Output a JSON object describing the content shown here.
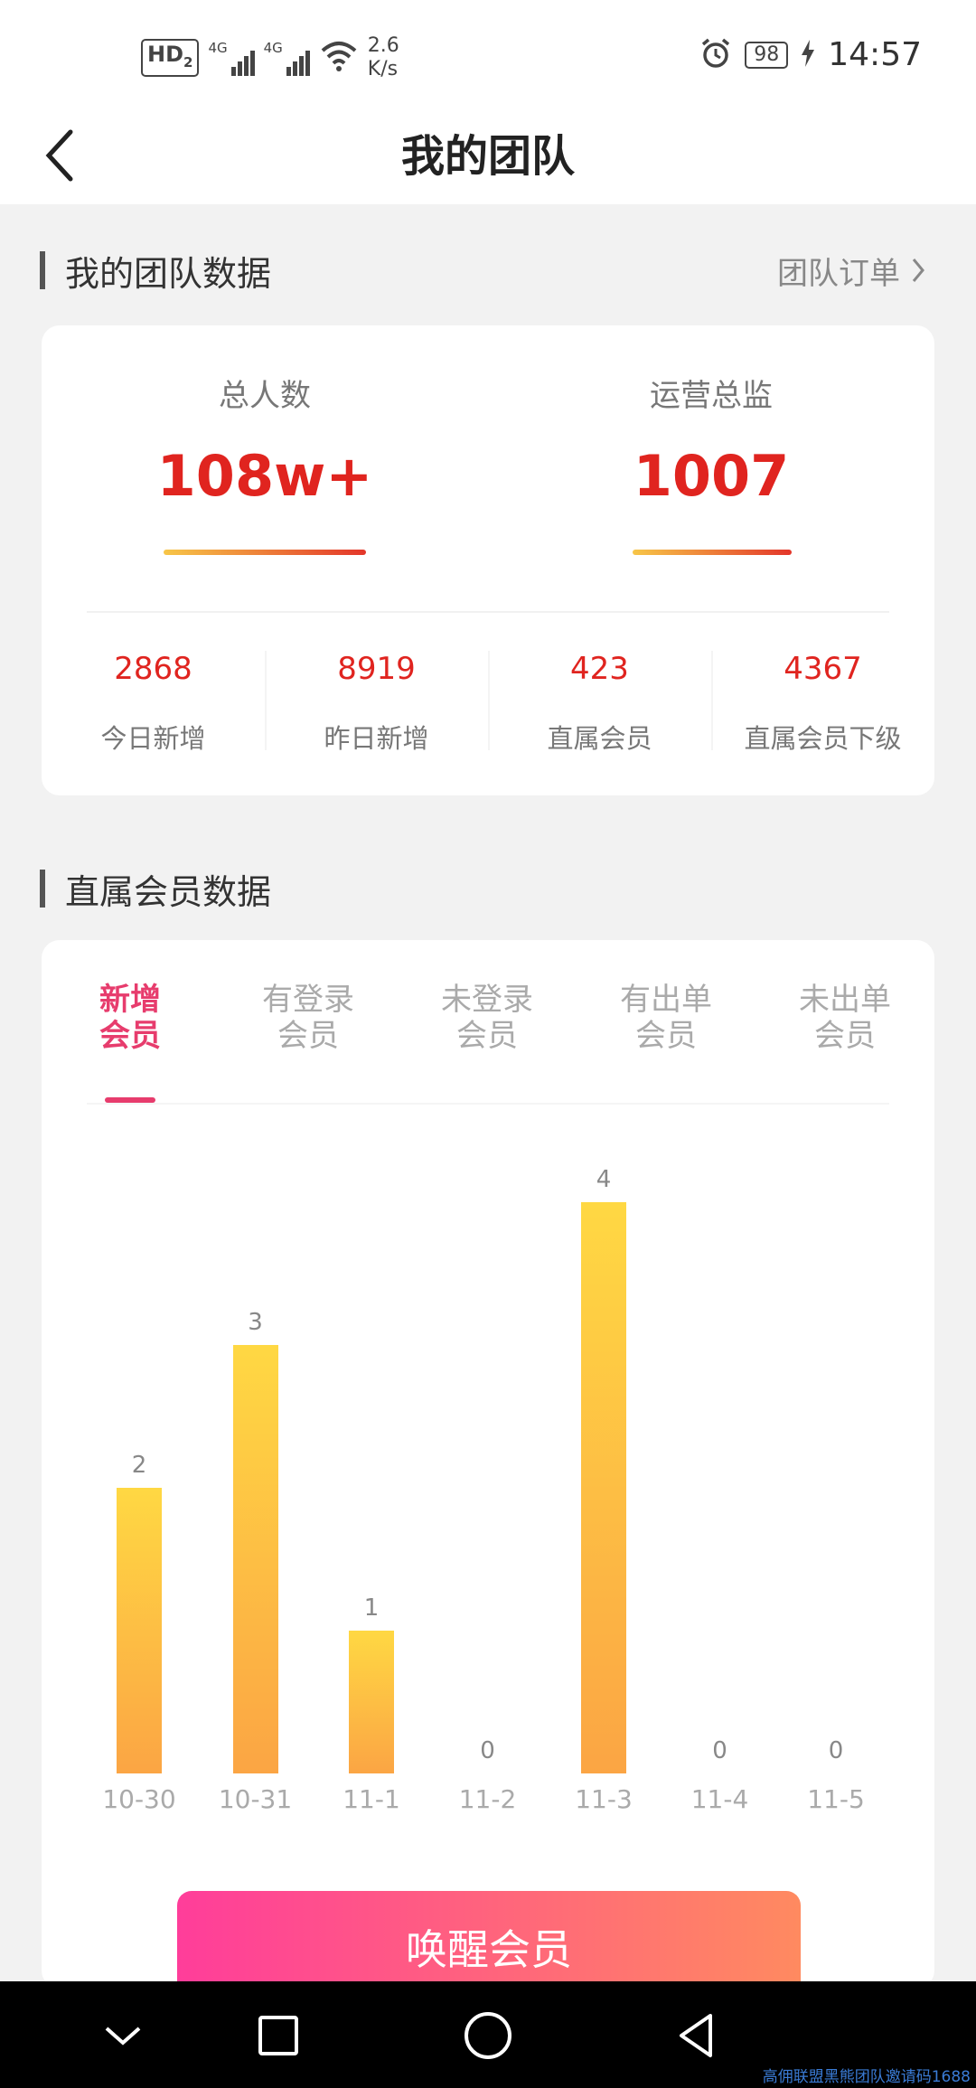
{
  "status_bar": {
    "hd": "HD",
    "hd_sub": "2",
    "net1": "4G",
    "net2": "4G",
    "speed_value": "2.6",
    "speed_unit": "K/s",
    "battery": "98",
    "time": "14:57"
  },
  "header": {
    "title": "我的团队"
  },
  "team_section": {
    "title": "我的团队数据",
    "orders_link": "团队订单",
    "total_label": "总人数",
    "total_value": "108w+",
    "ops_label": "运营总监",
    "ops_value": "1007",
    "stats": [
      {
        "value": "2868",
        "label": "今日新增"
      },
      {
        "value": "8919",
        "label": "昨日新增"
      },
      {
        "value": "423",
        "label": "直属会员"
      },
      {
        "value": "4367",
        "label": "直属会员下级"
      }
    ]
  },
  "member_section": {
    "title": "直属会员数据",
    "tabs": [
      {
        "line1": "新增",
        "line2": "会员",
        "active": true
      },
      {
        "line1": "有登录",
        "line2": "会员",
        "active": false
      },
      {
        "line1": "未登录",
        "line2": "会员",
        "active": false
      },
      {
        "line1": "有出单",
        "line2": "会员",
        "active": false
      },
      {
        "line1": "未出单",
        "line2": "会员",
        "active": false
      }
    ]
  },
  "chart_data": {
    "type": "bar",
    "categories": [
      "10-30",
      "10-31",
      "11-1",
      "11-2",
      "11-3",
      "11-4",
      "11-5"
    ],
    "values": [
      2,
      3,
      1,
      0,
      4,
      0,
      0
    ],
    "title": "",
    "xlabel": "",
    "ylabel": "",
    "ylim": [
      0,
      4
    ],
    "grid": false,
    "bar_gradient": [
      "#ffd843",
      "#fba544"
    ]
  },
  "actions": {
    "wake_button": "唤醒会员"
  },
  "watermark": "高佣联盟黑熊团队邀请码1688",
  "colors": {
    "accent_red": "#e0241f",
    "tab_active": "#e73c6d",
    "button_start": "#ff3d9a",
    "button_end": "#ff8a60"
  }
}
